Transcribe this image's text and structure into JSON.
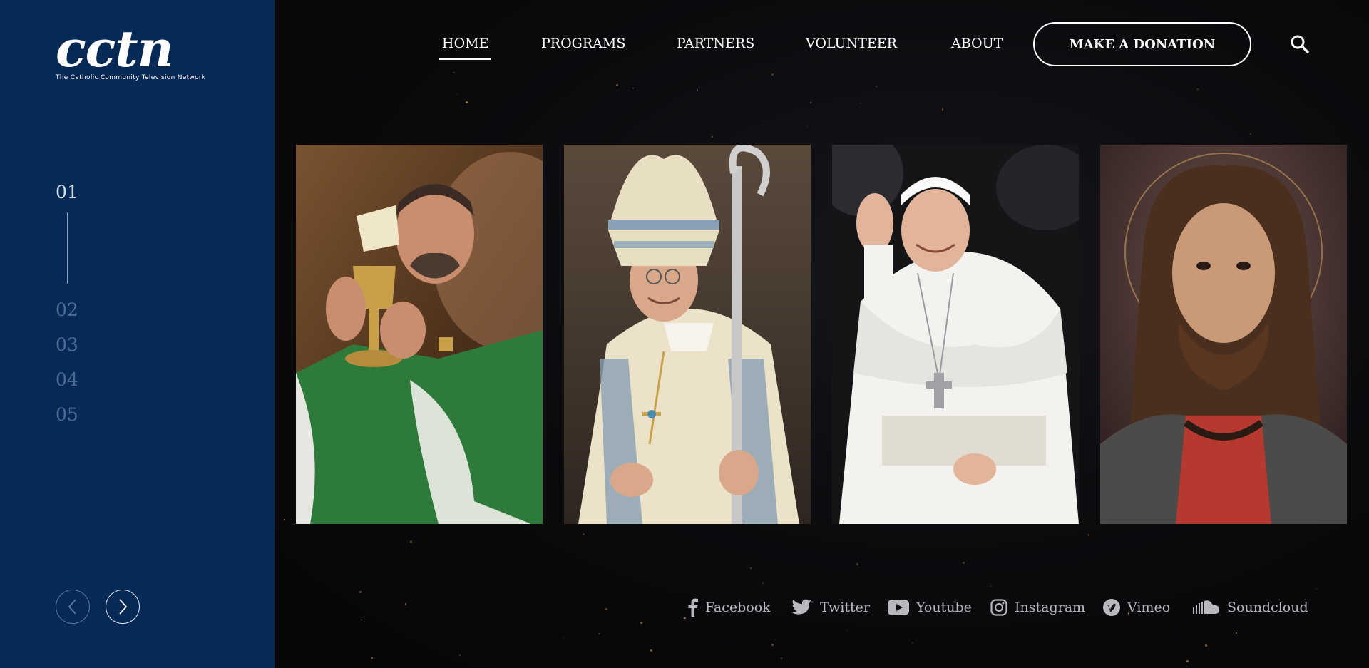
{
  "brand": {
    "logo_text": "cctn",
    "tagline": "The Catholic Community Television Network"
  },
  "slider": {
    "active": "01",
    "others": [
      "02",
      "03",
      "04",
      "05"
    ]
  },
  "nav": {
    "items": [
      {
        "label": "HOME",
        "active": true
      },
      {
        "label": "PROGRAMS",
        "active": false
      },
      {
        "label": "PARTNERS",
        "active": false
      },
      {
        "label": "VOLUNTEER",
        "active": false
      },
      {
        "label": "ABOUT",
        "active": false
      }
    ],
    "donate_label": "MAKE A DONATION"
  },
  "gallery": [
    {
      "subject": "priest-raising-chalice",
      "vestment_color": "#2f7a3c"
    },
    {
      "subject": "bishop-with-mitre-and-crozier",
      "vestment_color": "#e7dcc0"
    },
    {
      "subject": "pope-waving",
      "vestment_color": "#f4f3ef"
    },
    {
      "subject": "portrait-of-christ",
      "vestment_color": "#a8352c"
    }
  ],
  "social": [
    {
      "label": "Facebook",
      "icon": "facebook-icon"
    },
    {
      "label": "Twitter",
      "icon": "twitter-icon"
    },
    {
      "label": "Youtube",
      "icon": "youtube-icon"
    },
    {
      "label": "Instagram",
      "icon": "instagram-icon"
    },
    {
      "label": "Vimeo",
      "icon": "vimeo-icon"
    },
    {
      "label": "Soundcloud",
      "icon": "soundcloud-icon"
    }
  ],
  "colors": {
    "sidebar": "#062a55",
    "background": "#0a0a0c",
    "accent": "#ffffff",
    "muted_number": "#4e6c92"
  }
}
